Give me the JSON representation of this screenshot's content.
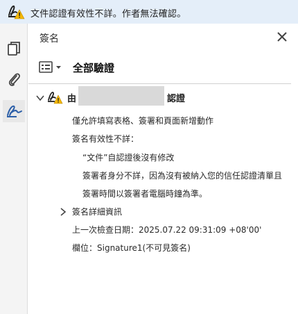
{
  "warning_bar": {
    "message": "文件認證有效性不詳。作者無法確認。",
    "icon": "signature-warning-icon"
  },
  "left_rail": {
    "items": [
      {
        "name": "pages-icon",
        "active": false
      },
      {
        "name": "attachment-icon",
        "active": false
      },
      {
        "name": "signature-panel-icon",
        "active": true
      }
    ]
  },
  "panel": {
    "title": "簽名",
    "close_icon": "close-icon",
    "options_icon": "options-menu-icon",
    "verify_all_label": "全部驗證"
  },
  "signature": {
    "by_label": "由",
    "signer_name": "",
    "certified_label": "認證",
    "details": {
      "permission_text": "僅允許填寫表格、簽署和頁面新增動作",
      "validity_heading": "簽名有效性不詳：",
      "validity_items": [
        "“文件”自認證後沒有修改",
        "簽署者身分不詳，因為沒有被納入您的信任認證清單且",
        "簽署時間以簽署者電腦時鐘為準。"
      ],
      "details_label": "簽名詳細資訊",
      "last_checked": "上一次檢查日期：2025.07.22 09:31:09 +08'00'",
      "field": "欄位：Signature1(不可見簽名)"
    }
  },
  "colors": {
    "warning_bar_bg": "#e4eef9",
    "accent_blue": "#2c5fa8",
    "warning_yellow": "#f5b800",
    "redaction_gray": "#d9d9d9"
  }
}
